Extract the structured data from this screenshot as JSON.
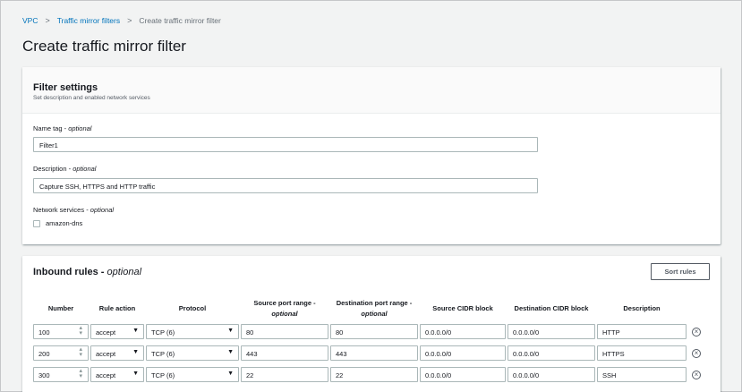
{
  "breadcrumb": {
    "items": [
      "VPC",
      "Traffic mirror filters"
    ],
    "current": "Create traffic mirror filter",
    "separator": ">"
  },
  "page": {
    "title": "Create traffic mirror filter"
  },
  "filter_settings": {
    "title": "Filter settings",
    "description": "Set description and enabled network services",
    "name_tag": {
      "label": "Name tag",
      "optional": "optional",
      "value": "Filter1"
    },
    "description_field": {
      "label": "Description",
      "optional": "optional",
      "value": "Capture SSH, HTTPS and HTTP traffic"
    },
    "network_services": {
      "label": "Network services",
      "optional": "optional",
      "option": "amazon-dns",
      "checked": false
    }
  },
  "inbound": {
    "title": "Inbound rules",
    "optional": "optional",
    "sort_button": "Sort rules",
    "columns": {
      "number": "Number",
      "rule_action": "Rule action",
      "protocol": "Protocol",
      "source_port": "Source port range -",
      "source_port_opt": "optional",
      "dest_port": "Destination port range -",
      "dest_port_opt": "optional",
      "source_cidr": "Source CIDR block",
      "dest_cidr": "Destination CIDR block",
      "description": "Description"
    },
    "rows": [
      {
        "number": "100",
        "action": "accept",
        "protocol": "TCP (6)",
        "source_port": "80",
        "dest_port": "80",
        "source_cidr": "0.0.0.0/0",
        "dest_cidr": "0.0.0.0/0",
        "description": "HTTP"
      },
      {
        "number": "200",
        "action": "accept",
        "protocol": "TCP (6)",
        "source_port": "443",
        "dest_port": "443",
        "source_cidr": "0.0.0.0/0",
        "dest_cidr": "0.0.0.0/0",
        "description": "HTTPS"
      },
      {
        "number": "300",
        "action": "accept",
        "protocol": "TCP (6)",
        "source_port": "22",
        "dest_port": "22",
        "source_cidr": "0.0.0.0/0",
        "dest_cidr": "0.0.0.0/0",
        "description": "SSH"
      }
    ]
  },
  "icons": {
    "dropdown": "caret-down-icon",
    "stepper": "stepper-icon",
    "remove": "remove-circle-icon",
    "separator": "chevron-right-icon"
  },
  "colors": {
    "link": "#0073bb",
    "background": "#f2f3f3",
    "border": "#aab7b8"
  }
}
